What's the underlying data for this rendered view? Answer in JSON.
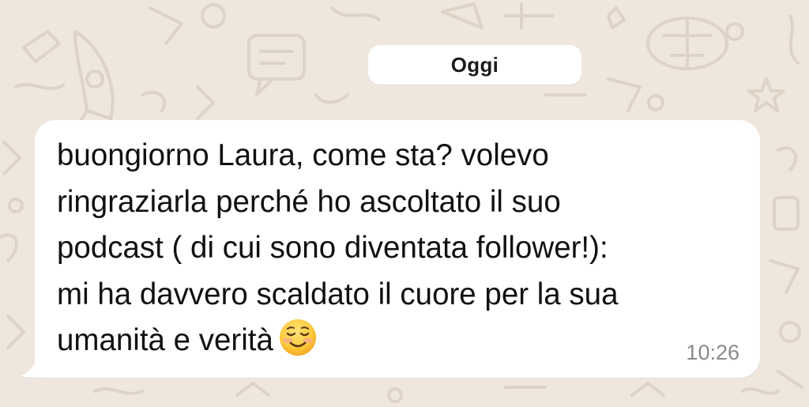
{
  "chat": {
    "date_label": "Oggi",
    "message": {
      "text": "buongiorno Laura, come sta? volevo\nringraziarla perché ho ascoltato il suo\npodcast ( di cui sono diventata follower!):\nmi ha davvero scaldato il cuore per la sua\numanità e verità",
      "emoji_icon": "smiling-face-icon",
      "time": "10:26"
    }
  },
  "colors": {
    "wallpaper": "#EFE7DD",
    "wallpaper_doodle": "#DDD3C6",
    "bubble": "#FFFFFF",
    "date_pill": "#FFFFFF",
    "text": "#111111",
    "timestamp": "#8A8A8A"
  }
}
